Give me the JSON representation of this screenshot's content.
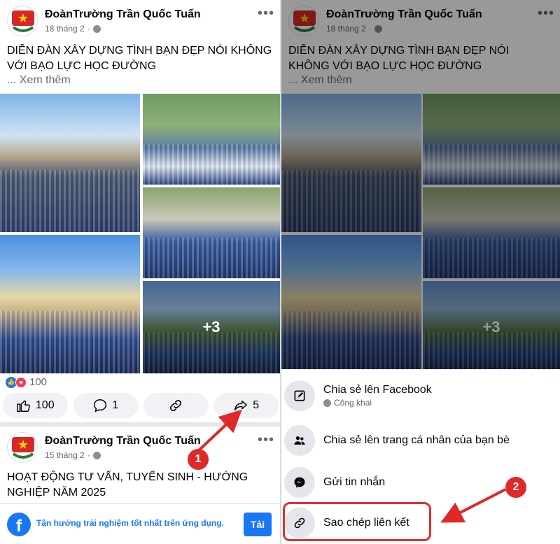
{
  "post": {
    "page_name": "ĐoànTrường Trần Quốc Tuấn",
    "date": "18 tháng 2",
    "title": "DIỄN ĐÀN XÂY DỰNG TÌNH BẠN ĐẸP NÓI KHÔNG VỚI BẠO LỰC HỌC ĐƯỜNG",
    "see_more": "... Xem thêm",
    "extra_photos": "+3",
    "reaction_count": "100",
    "like_count": "100",
    "comment_count": "1",
    "share_count": "5"
  },
  "post2": {
    "page_name": "ĐoànTrường Trần Quốc Tuấn",
    "date": "15 tháng 2",
    "title": "HOẠT ĐỘNG TƯ VẤN, TUYỂN SINH - HƯỚNG NGHIỆP NĂM 2025"
  },
  "app_banner": {
    "text": "Tận hưởng trải nghiệm tốt nhất trên ứng dụng.",
    "button": "Tải"
  },
  "share_sheet": {
    "items": [
      {
        "label": "Chia sẻ lên Facebook",
        "sub": "Công khai",
        "icon": "edit-icon"
      },
      {
        "label": "Chia sẻ lên trang cá nhân của bạn bè",
        "icon": "friends-icon"
      },
      {
        "label": "Gửi tin nhắn",
        "icon": "messenger-icon"
      },
      {
        "label": "Sao chép liên kết",
        "icon": "link-icon"
      }
    ]
  },
  "annotations": {
    "step1": "1",
    "step2": "2"
  },
  "colors": {
    "facebook_blue": "#1877f2",
    "annotation_red": "#e02828"
  }
}
